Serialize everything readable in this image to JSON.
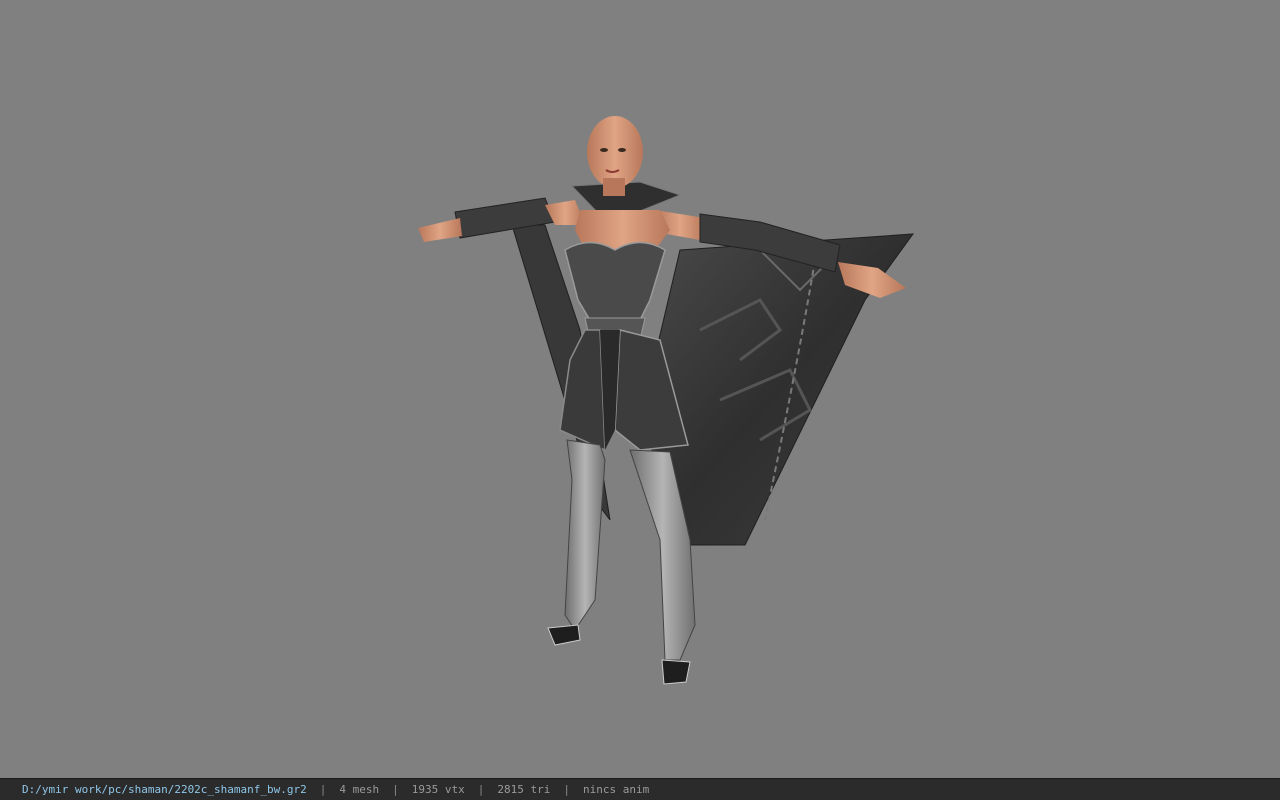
{
  "viewport": {
    "background": "#808080"
  },
  "status_bar": {
    "file_path": "D:/ymir work/pc/shaman/2202c_shamanf_bw.gr2",
    "separator": "|",
    "mesh_count": "4 mesh",
    "vertex_count": "1935 vtx",
    "triangle_count": "2815 tri",
    "animation": "nincs anim",
    "path_color": "#8ec6e8",
    "background": "#2b2b2b"
  },
  "model": {
    "description_icon": "character-model-render",
    "skin_color": "#c98b6a",
    "armor_color": "#3a3a3a",
    "armor_highlight": "#9a9a9a",
    "cape_color": "#2e2e2e"
  }
}
